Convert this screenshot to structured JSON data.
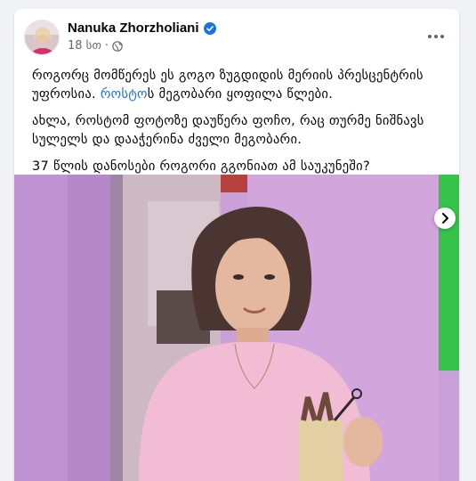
{
  "post": {
    "author": "Nanuka Zhorzholiani",
    "time": "18 სთ",
    "separator": "·",
    "paragraphs": {
      "p1_before_mention": "როგორც მომწერეს ეს გოგო ზუგდიდის მერიის პრესცენტრის უფროსია. ",
      "mention": "როსტო",
      "p1_after_mention": "ს მეგობარი ყოფილა წლები.",
      "p2": "ახლა, როსტომ ფოტოზე დაუწერა ფოჩო, რაც თურმე ნიშნავს სულელს და დააჭერინა ძველი მეგობარი.",
      "p3": "37 წლის დანოსები როგორი გგონიათ ამ საუკუნეში?"
    }
  },
  "icons": {
    "verified": "verified-badge-icon",
    "audience": "globe-icon",
    "more": "more-horizontal-icon",
    "next": "chevron-right-icon"
  },
  "colors": {
    "link": "#216fdb",
    "verified": "#1b74e4",
    "secondary_text": "#65676b",
    "photo_wall": "#c9a0d8"
  }
}
